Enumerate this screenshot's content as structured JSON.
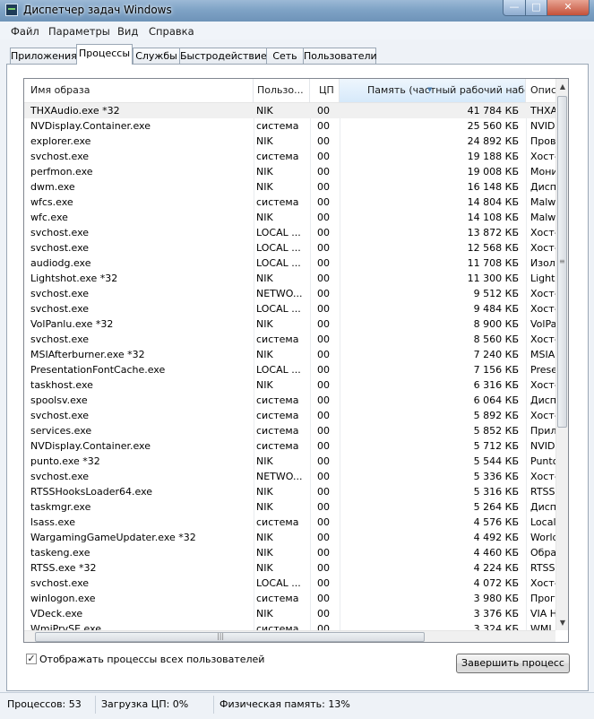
{
  "window": {
    "title": "Диспетчер задач Windows",
    "controls": {
      "minimize": "—",
      "maximize": "□",
      "close": "✕"
    }
  },
  "menu": [
    "Файл",
    "Параметры",
    "Вид",
    "Справка"
  ],
  "tabs": [
    "Приложения",
    "Процессы",
    "Службы",
    "Быстродействие",
    "Сеть",
    "Пользователи"
  ],
  "active_tab": "Процессы",
  "table": {
    "columns": [
      "Имя образа",
      "Пользо...",
      "ЦП",
      "Память (частный рабочий набор)",
      "Описа"
    ],
    "sorted_column": "Память (частный рабочий набор)",
    "rows": [
      [
        "THXAudio.exe *32",
        "NIK",
        "00",
        "41 784 КБ",
        "THXA"
      ],
      [
        "NVDisplay.Container.exe",
        "система",
        "00",
        "25 560 КБ",
        "NVIDI"
      ],
      [
        "explorer.exe",
        "NIK",
        "00",
        "24 892 КБ",
        "Прово"
      ],
      [
        "svchost.exe",
        "система",
        "00",
        "19 188 КБ",
        "Хост-"
      ],
      [
        "perfmon.exe",
        "NIK",
        "00",
        "19 008 КБ",
        "Мони"
      ],
      [
        "dwm.exe",
        "NIK",
        "00",
        "16 148 КБ",
        "Диспе"
      ],
      [
        "wfcs.exe",
        "система",
        "00",
        "14 804 КБ",
        "Malwa"
      ],
      [
        "wfc.exe",
        "NIK",
        "00",
        "14 108 КБ",
        "Malwa"
      ],
      [
        "svchost.exe",
        "LOCAL ...",
        "00",
        "13 872 КБ",
        "Хост-"
      ],
      [
        "svchost.exe",
        "LOCAL ...",
        "00",
        "12 568 КБ",
        "Хост-"
      ],
      [
        "audiodg.exe",
        "LOCAL ...",
        "00",
        "11 708 КБ",
        "Изоля"
      ],
      [
        "Lightshot.exe *32",
        "NIK",
        "00",
        "11 300 КБ",
        "Lights"
      ],
      [
        "svchost.exe",
        "NETWO...",
        "00",
        "9 512 КБ",
        "Хост-"
      ],
      [
        "svchost.exe",
        "LOCAL ...",
        "00",
        "9 484 КБ",
        "Хост-"
      ],
      [
        "VolPanlu.exe *32",
        "NIK",
        "00",
        "8 900 КБ",
        "VolPa"
      ],
      [
        "svchost.exe",
        "система",
        "00",
        "8 560 КБ",
        "Хост-"
      ],
      [
        "MSIAfterburner.exe *32",
        "NIK",
        "00",
        "7 240 КБ",
        "MSIA"
      ],
      [
        "PresentationFontCache.exe",
        "LOCAL ...",
        "00",
        "7 156 КБ",
        "Prese"
      ],
      [
        "taskhost.exe",
        "NIK",
        "00",
        "6 316 КБ",
        "Хост-"
      ],
      [
        "spoolsv.exe",
        "система",
        "00",
        "6 064 КБ",
        "Диспе"
      ],
      [
        "svchost.exe",
        "система",
        "00",
        "5 892 КБ",
        "Хост-"
      ],
      [
        "services.exe",
        "система",
        "00",
        "5 852 КБ",
        "Прило"
      ],
      [
        "NVDisplay.Container.exe",
        "система",
        "00",
        "5 712 КБ",
        "NVIDI"
      ],
      [
        "punto.exe *32",
        "NIK",
        "00",
        "5 544 КБ",
        "Punto"
      ],
      [
        "svchost.exe",
        "NETWO...",
        "00",
        "5 336 КБ",
        "Хост-"
      ],
      [
        "RTSSHooksLoader64.exe",
        "NIK",
        "00",
        "5 316 КБ",
        "RTSS"
      ],
      [
        "taskmgr.exe",
        "NIK",
        "00",
        "5 264 КБ",
        "Диспе"
      ],
      [
        "lsass.exe",
        "система",
        "00",
        "4 576 КБ",
        "Local"
      ],
      [
        "WargamingGameUpdater.exe *32",
        "NIK",
        "00",
        "4 492 КБ",
        "World"
      ],
      [
        "taskeng.exe",
        "NIK",
        "00",
        "4 460 КБ",
        "Обра"
      ],
      [
        "RTSS.exe *32",
        "NIK",
        "00",
        "4 224 КБ",
        "RTSS"
      ],
      [
        "svchost.exe",
        "LOCAL ...",
        "00",
        "4 072 КБ",
        "Хост-"
      ],
      [
        "winlogon.exe",
        "система",
        "00",
        "3 980 КБ",
        "Прогр"
      ],
      [
        "VDeck.exe",
        "NIK",
        "00",
        "3 376 КБ",
        "VIA H"
      ],
      [
        "WmiPrvSE.exe",
        "система",
        "00",
        "3 324 КБ",
        "WMI I"
      ]
    ],
    "selected_row": 0
  },
  "show_all_users": {
    "label": "Отображать процессы всех пользователей",
    "checked": true
  },
  "end_process_button": "Завершить процесс",
  "status": {
    "processes": "Процессов: 53",
    "cpu": "Загрузка ЦП: 0%",
    "memory": "Физическая память: 13%"
  }
}
